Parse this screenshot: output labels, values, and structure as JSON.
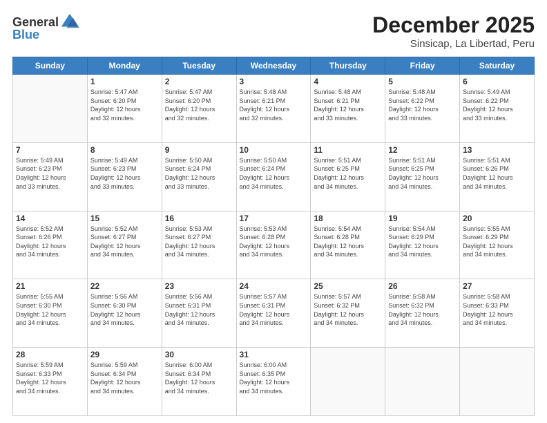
{
  "header": {
    "logo_general": "General",
    "logo_blue": "Blue",
    "month": "December 2025",
    "location": "Sinsicap, La Libertad, Peru"
  },
  "days_of_week": [
    "Sunday",
    "Monday",
    "Tuesday",
    "Wednesday",
    "Thursday",
    "Friday",
    "Saturday"
  ],
  "weeks": [
    [
      {
        "day": "",
        "info": ""
      },
      {
        "day": "1",
        "info": "Sunrise: 5:47 AM\nSunset: 6:20 PM\nDaylight: 12 hours\nand 32 minutes."
      },
      {
        "day": "2",
        "info": "Sunrise: 5:47 AM\nSunset: 6:20 PM\nDaylight: 12 hours\nand 32 minutes."
      },
      {
        "day": "3",
        "info": "Sunrise: 5:48 AM\nSunset: 6:21 PM\nDaylight: 12 hours\nand 32 minutes."
      },
      {
        "day": "4",
        "info": "Sunrise: 5:48 AM\nSunset: 6:21 PM\nDaylight: 12 hours\nand 33 minutes."
      },
      {
        "day": "5",
        "info": "Sunrise: 5:48 AM\nSunset: 6:22 PM\nDaylight: 12 hours\nand 33 minutes."
      },
      {
        "day": "6",
        "info": "Sunrise: 5:49 AM\nSunset: 6:22 PM\nDaylight: 12 hours\nand 33 minutes."
      }
    ],
    [
      {
        "day": "7",
        "info": "Sunrise: 5:49 AM\nSunset: 6:23 PM\nDaylight: 12 hours\nand 33 minutes."
      },
      {
        "day": "8",
        "info": "Sunrise: 5:49 AM\nSunset: 6:23 PM\nDaylight: 12 hours\nand 33 minutes."
      },
      {
        "day": "9",
        "info": "Sunrise: 5:50 AM\nSunset: 6:24 PM\nDaylight: 12 hours\nand 33 minutes."
      },
      {
        "day": "10",
        "info": "Sunrise: 5:50 AM\nSunset: 6:24 PM\nDaylight: 12 hours\nand 34 minutes."
      },
      {
        "day": "11",
        "info": "Sunrise: 5:51 AM\nSunset: 6:25 PM\nDaylight: 12 hours\nand 34 minutes."
      },
      {
        "day": "12",
        "info": "Sunrise: 5:51 AM\nSunset: 6:25 PM\nDaylight: 12 hours\nand 34 minutes."
      },
      {
        "day": "13",
        "info": "Sunrise: 5:51 AM\nSunset: 6:26 PM\nDaylight: 12 hours\nand 34 minutes."
      }
    ],
    [
      {
        "day": "14",
        "info": "Sunrise: 5:52 AM\nSunset: 6:26 PM\nDaylight: 12 hours\nand 34 minutes."
      },
      {
        "day": "15",
        "info": "Sunrise: 5:52 AM\nSunset: 6:27 PM\nDaylight: 12 hours\nand 34 minutes."
      },
      {
        "day": "16",
        "info": "Sunrise: 5:53 AM\nSunset: 6:27 PM\nDaylight: 12 hours\nand 34 minutes."
      },
      {
        "day": "17",
        "info": "Sunrise: 5:53 AM\nSunset: 6:28 PM\nDaylight: 12 hours\nand 34 minutes."
      },
      {
        "day": "18",
        "info": "Sunrise: 5:54 AM\nSunset: 6:28 PM\nDaylight: 12 hours\nand 34 minutes."
      },
      {
        "day": "19",
        "info": "Sunrise: 5:54 AM\nSunset: 6:29 PM\nDaylight: 12 hours\nand 34 minutes."
      },
      {
        "day": "20",
        "info": "Sunrise: 5:55 AM\nSunset: 6:29 PM\nDaylight: 12 hours\nand 34 minutes."
      }
    ],
    [
      {
        "day": "21",
        "info": "Sunrise: 5:55 AM\nSunset: 6:30 PM\nDaylight: 12 hours\nand 34 minutes."
      },
      {
        "day": "22",
        "info": "Sunrise: 5:56 AM\nSunset: 6:30 PM\nDaylight: 12 hours\nand 34 minutes."
      },
      {
        "day": "23",
        "info": "Sunrise: 5:56 AM\nSunset: 6:31 PM\nDaylight: 12 hours\nand 34 minutes."
      },
      {
        "day": "24",
        "info": "Sunrise: 5:57 AM\nSunset: 6:31 PM\nDaylight: 12 hours\nand 34 minutes."
      },
      {
        "day": "25",
        "info": "Sunrise: 5:57 AM\nSunset: 6:32 PM\nDaylight: 12 hours\nand 34 minutes."
      },
      {
        "day": "26",
        "info": "Sunrise: 5:58 AM\nSunset: 6:32 PM\nDaylight: 12 hours\nand 34 minutes."
      },
      {
        "day": "27",
        "info": "Sunrise: 5:58 AM\nSunset: 6:33 PM\nDaylight: 12 hours\nand 34 minutes."
      }
    ],
    [
      {
        "day": "28",
        "info": "Sunrise: 5:59 AM\nSunset: 6:33 PM\nDaylight: 12 hours\nand 34 minutes."
      },
      {
        "day": "29",
        "info": "Sunrise: 5:59 AM\nSunset: 6:34 PM\nDaylight: 12 hours\nand 34 minutes."
      },
      {
        "day": "30",
        "info": "Sunrise: 6:00 AM\nSunset: 6:34 PM\nDaylight: 12 hours\nand 34 minutes."
      },
      {
        "day": "31",
        "info": "Sunrise: 6:00 AM\nSunset: 6:35 PM\nDaylight: 12 hours\nand 34 minutes."
      },
      {
        "day": "",
        "info": ""
      },
      {
        "day": "",
        "info": ""
      },
      {
        "day": "",
        "info": ""
      }
    ]
  ]
}
